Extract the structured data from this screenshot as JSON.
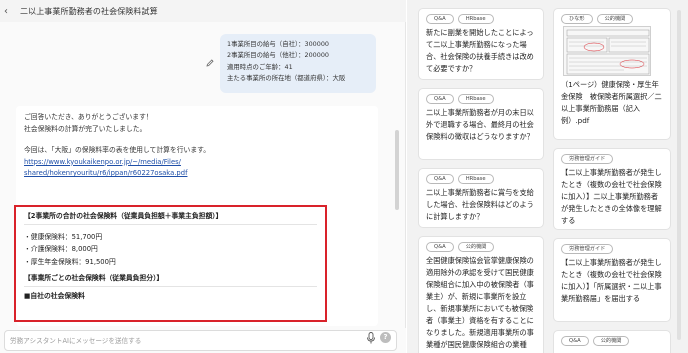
{
  "header": {
    "title": "二以上事業所勤務者の社会保険料試算",
    "back_label": "‹"
  },
  "user_message": {
    "lines": [
      "1事業所目の給与（自社）：300000",
      "2事業所目の給与（他社）：200000",
      "適用時点のご年齢：41",
      "主たる事業所の所在地（都道府県）：大阪"
    ]
  },
  "assistant_message": {
    "intro1": "ご回答いただき、ありがとうございます！",
    "intro2": "社会保険料の計算が完了いたしました。",
    "intro3": "今回は、「大阪」の保険料率の表を使用して計算を行います。",
    "link1": "https://www.kyoukaikenpo.or.jp/~/media/Files/",
    "link2": "shared/hokenryouritu/r6/ippan/r60227osaka.pdf"
  },
  "result": {
    "heading1": "【2事業所の合計の社会保険料（従業員負担額＋事業主負担額）】",
    "health": "・健康保険料：51,700円",
    "care": "・介護保険料：8,000円",
    "pension": "・厚生年金保険料：91,500円",
    "heading2": "【事業所ごとの社会保険料（従業員負担分）】",
    "heading3": "■自社の社会保険料"
  },
  "composer": {
    "placeholder": "労務アシスタントAIにメッセージを送信する",
    "help": "?"
  },
  "cards_col1": [
    {
      "tags": [
        "Q&A",
        "HRbase"
      ],
      "text": "新たに副業を開始したことによって二以上事業所勤務になった場合、社会保険の扶養手続きは改めて必要ですか？"
    },
    {
      "tags": [
        "Q&A",
        "HRbase"
      ],
      "text": "二以上事業所勤務者が月の末日以外で退職する場合、最終月の社会保険料の徴収はどうなりますか？"
    },
    {
      "tags": [
        "Q&A",
        "HRbase"
      ],
      "text": "二以上事業所勤務者に賞与を支給した場合、社会保険料はどのように計算しますか？"
    },
    {
      "tags": [
        "Q&A",
        "公的機関"
      ],
      "text": "全国健康保険協会管掌健康保険の適用除外の承認を受けて国民健康保険組合に加入中の被保険者（事業主）が、新規に事業所を設立し、新規事業所においても被保険者（事業主）資格を有することになりました。新規適用事業所の事業種が国民健康保険組合の業種"
    }
  ],
  "cards_col2": [
    {
      "tags": [
        "ひな形",
        "公的機関"
      ],
      "text": "（1ページ）健康保険・厚生年金保険　被保険者所属選択／二以上事業所勤務届（記入例）.pdf"
    },
    {
      "tags": [
        "労務管理ガイド"
      ],
      "text": "【二以上事業所勤務者が発生したとき（複数の会社で社会保険に加入）】二以上事業所勤務者が発生したときの全体像を理解する"
    },
    {
      "tags": [
        "労務管理ガイド"
      ],
      "text": "【二以上事業所勤務者が発生したとき（複数の会社で社会保険に加入）】「所属選択・二以上事業所勤務届」を届出する"
    },
    {
      "tags": [
        "Q&A",
        "公的機関"
      ],
      "text": ""
    }
  ]
}
